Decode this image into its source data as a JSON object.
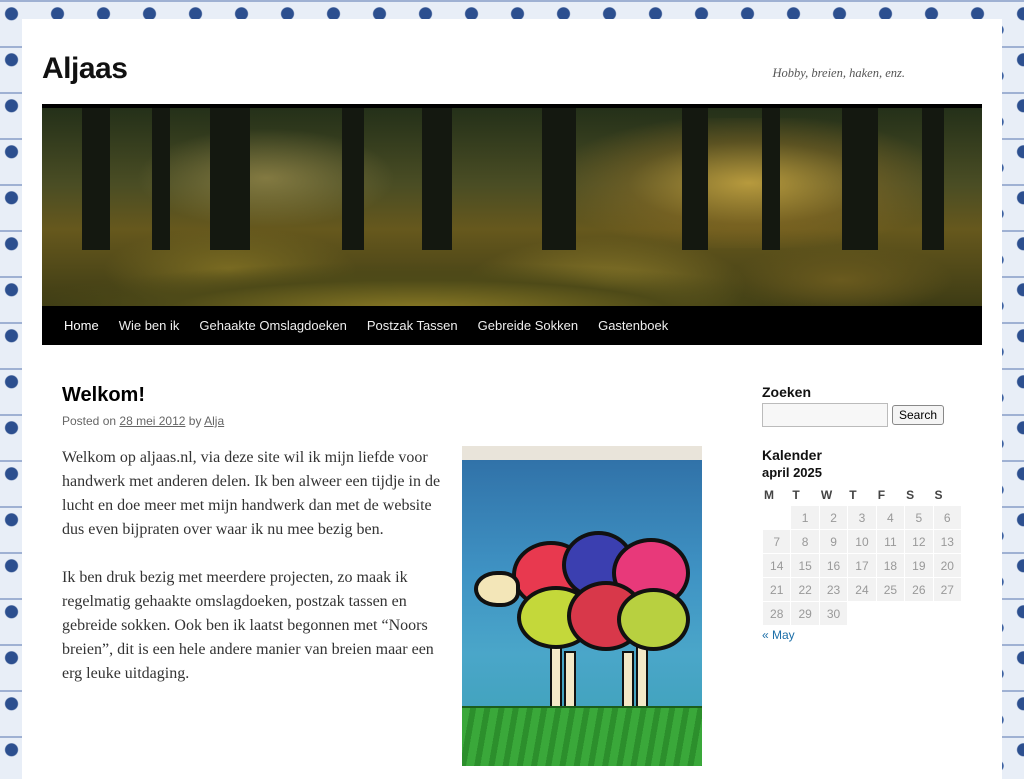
{
  "site": {
    "title": "Aljaas",
    "description": "Hobby, breien, haken, enz."
  },
  "nav": {
    "items": [
      {
        "label": "Home",
        "current": true
      },
      {
        "label": "Wie ben ik"
      },
      {
        "label": "Gehaakte Omslagdoeken"
      },
      {
        "label": "Postzak Tassen"
      },
      {
        "label": "Gebreide Sokken"
      },
      {
        "label": "Gastenboek"
      }
    ]
  },
  "post": {
    "title": "Welkom!",
    "meta_prefix": "Posted on",
    "date": "28 mei 2012",
    "by": "by",
    "author": "Alja",
    "paragraphs": [
      "Welkom op aljaas.nl, via deze site wil ik mijn liefde voor handwerk met anderen delen. Ik ben alweer een tijdje in de lucht en doe meer met mijn handwerk dan met de website dus even bijpraten over waar ik nu mee bezig ben.",
      "Ik ben druk bezig met meerdere projecten, zo maak ik regelmatig gehaakte omslagdoeken, postzak tassen en gebreide  sokken. Ook ben ik laatst begonnen met “Noors breien”, dit is een hele andere manier van breien maar een erg leuke uitdaging."
    ]
  },
  "sidebar": {
    "search": {
      "title": "Zoeken",
      "value": "",
      "button": "Search"
    },
    "calendar": {
      "title": "Kalender",
      "caption": "april 2025",
      "weekdays": [
        "M",
        "T",
        "W",
        "T",
        "F",
        "S",
        "S"
      ],
      "weeks": [
        [
          "",
          "1",
          "2",
          "3",
          "4",
          "5",
          "6"
        ],
        [
          "7",
          "8",
          "9",
          "10",
          "11",
          "12",
          "13"
        ],
        [
          "14",
          "15",
          "16",
          "17",
          "18",
          "19",
          "20"
        ],
        [
          "21",
          "22",
          "23",
          "24",
          "25",
          "26",
          "27"
        ],
        [
          "28",
          "29",
          "30",
          "",
          "",
          "",
          ""
        ]
      ],
      "prev_link": "« May"
    }
  }
}
